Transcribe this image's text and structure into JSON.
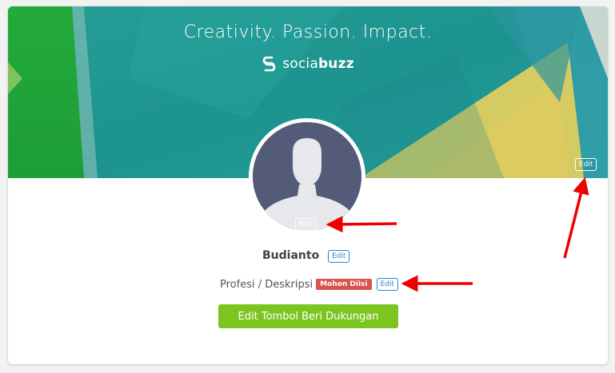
{
  "cover": {
    "tagline": "Creativity. Passion. Impact.",
    "brand_name_light": "socia",
    "brand_name_bold": "buzz",
    "brand_icon": "s-logo-icon",
    "edit_label": "Edit"
  },
  "avatar": {
    "icon": "person-silhouette-icon",
    "edit_label": "Edit"
  },
  "profile": {
    "name": "Budianto",
    "name_edit_label": "Edit",
    "profession_label": "Profesi / Deskripsi",
    "profession_badge": "Mohon Diisi",
    "profession_edit_label": "Edit"
  },
  "support_button": {
    "label": "Edit Tombol Beri Dukungan"
  },
  "colors": {
    "support_button": "#7cc520",
    "badge": "#d9534f",
    "edit_blue": "#2f86c9",
    "avatar_bg": "#545b79",
    "annotation_arrow": "#ee0000"
  },
  "annotations": {
    "arrow_count": 3,
    "arrow_icon": "red-arrow-icon"
  }
}
